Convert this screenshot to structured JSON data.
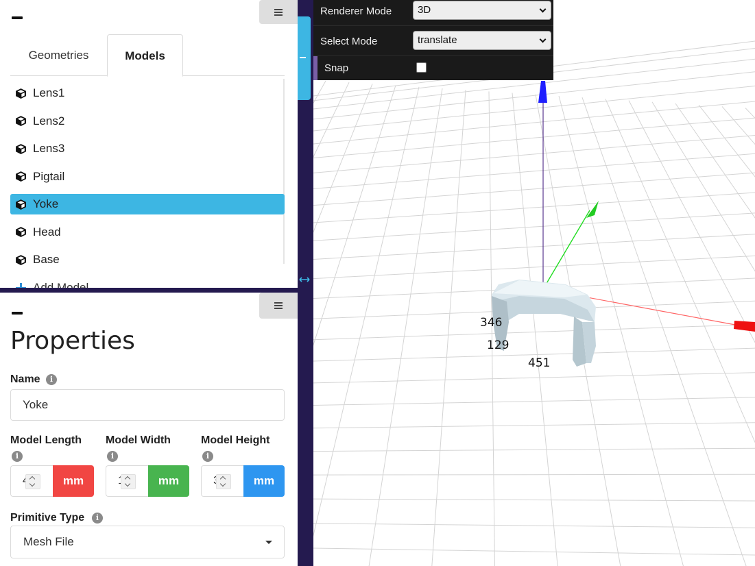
{
  "model_panel": {
    "tabs": [
      {
        "label": "Geometries",
        "active": false
      },
      {
        "label": "Models",
        "active": true
      }
    ],
    "items": [
      {
        "label": "Lens1",
        "icon": "cube-icon",
        "selected": false
      },
      {
        "label": "Lens2",
        "icon": "cube-icon",
        "selected": false
      },
      {
        "label": "Lens3",
        "icon": "cube-icon",
        "selected": false
      },
      {
        "label": "Pigtail",
        "icon": "cube-icon",
        "selected": false
      },
      {
        "label": "Yoke",
        "icon": "cube-icon",
        "selected": true
      },
      {
        "label": "Head",
        "icon": "cube-icon",
        "selected": false
      },
      {
        "label": "Base",
        "icon": "cube-icon",
        "selected": false
      }
    ],
    "add_label": "Add Model"
  },
  "properties": {
    "title": "Properties",
    "name_label": "Name",
    "name_value": "Yoke",
    "length_label": "Model Length",
    "width_label": "Model Width",
    "height_label": "Model Height",
    "length_digit": "4",
    "width_digit": "1",
    "height_digit": "3",
    "unit": "mm",
    "primitive_label": "Primitive Type",
    "primitive_value": "Mesh File",
    "colors": {
      "length": "#f14643",
      "width": "#48b44f",
      "height": "#2e96f0",
      "accent": "#3db6e3"
    }
  },
  "gui": {
    "renderer_mode_label": "Renderer Mode",
    "renderer_mode_value": "3D",
    "select_mode_label": "Select Mode",
    "select_mode_value": "translate",
    "snap_label": "Snap",
    "snap_checked": false
  },
  "viewport": {
    "dimension_labels": [
      "346",
      "129",
      "451"
    ],
    "axis_colors": {
      "x": "#ff0000",
      "y": "#00cc00",
      "z": "#0000ff"
    }
  }
}
